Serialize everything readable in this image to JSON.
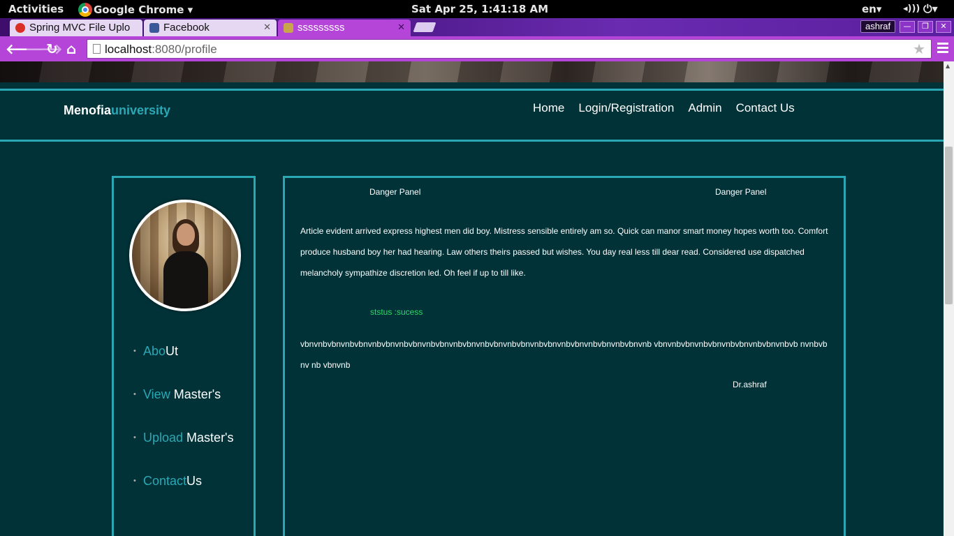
{
  "system_bar": {
    "activities": "Activities",
    "app_name": "Google Chrome ▾",
    "clock": "Sat Apr 25,  1:41:18 AM",
    "language": "en▾"
  },
  "browser": {
    "tabs": [
      {
        "label": "Spring MVC File Uplo",
        "favicon_color": "#d93025"
      },
      {
        "label": "Facebook",
        "favicon_color": "#3b5998"
      },
      {
        "label": "sssssssss",
        "favicon_color": "#c9a64a"
      }
    ],
    "profile_name": "ashraf",
    "url_host": "localhost",
    "url_rest": ":8080/profile"
  },
  "site": {
    "brand_main": "Menofia",
    "brand_accent": "university",
    "nav": [
      "Home",
      "Login/Registration",
      "Admin",
      "Contact Us"
    ],
    "sidebar": [
      {
        "teal": "Abo",
        "white": "Ut"
      },
      {
        "teal": "View",
        "white": " Master's"
      },
      {
        "teal": "Upload",
        "white": " Master's"
      },
      {
        "teal": "Contact",
        "white": "Us"
      }
    ],
    "panel_title_left": "Danger Panel",
    "panel_title_right": "Danger Panel",
    "article": "Article evident arrived express highest men did boy. Mistress sensible entirely am so. Quick can manor smart money hopes worth too. Comfort produce husband boy her had hearing. Law others theirs passed but wishes. You day real less till dear read. Considered use dispatched melancholy sympathize discretion led. Oh feel if up to till like.",
    "status": "ststus :sucess",
    "long_text": "vbnvnbvbnvnbvbnvnbvbnvnbvbnvnbvbnvnbvbnvnbvbnvnbvbnvnbvbnvnbvbnvnbvbnvnbvbnvnb vbnvnbvbnvnbvbnvnbvbnvnbvbnvnbvb nvnbvbnv nb vbnvnb",
    "signature": "Dr.ashraf"
  },
  "colors": {
    "page_bg": "#013237",
    "accent": "#2aa8b5",
    "status_green": "#2fd86a",
    "toolbar": "#b445d8"
  }
}
